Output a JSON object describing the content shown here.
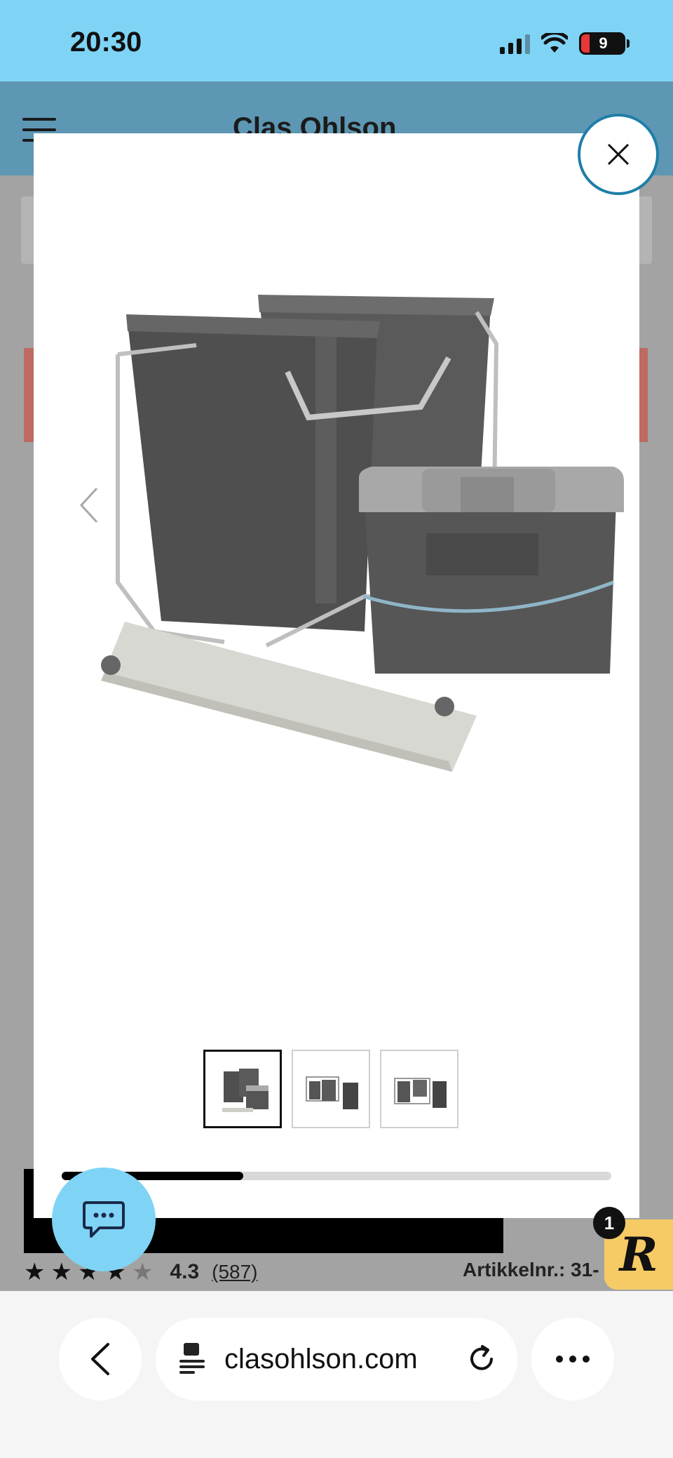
{
  "status_bar": {
    "time": "20:30",
    "battery_level": "9",
    "icons": [
      "signal-icon",
      "wifi-icon",
      "battery-icon"
    ]
  },
  "site_behind": {
    "logo": "Clas Ohlson",
    "rating_value": "4.3",
    "rating_count": "(587)",
    "rating_stars": 4.3,
    "article_number": "Artikkelnr.: 31-"
  },
  "modal": {
    "close_icon": "close-icon",
    "prev_icon": "chevron-left-icon",
    "next_icon": "chevron-right-icon",
    "image_name": "product-image-waste-bins",
    "thumbnails": [
      {
        "name": "thumb-1",
        "active": true
      },
      {
        "name": "thumb-2",
        "active": false
      },
      {
        "name": "thumb-3",
        "active": false
      }
    ],
    "progress": 0.33
  },
  "widgets": {
    "chat_icon": "chat-icon",
    "r_badge_letter": "R",
    "notification_count": "1"
  },
  "browser": {
    "url": "clasohlson.com",
    "back_icon": "back-icon",
    "reader_icon": "page-settings-icon",
    "reload_icon": "reload-icon",
    "more_icon": "more-icon"
  },
  "colors": {
    "status_bar": "#7fd4f6",
    "close_border": "#1e7ea8",
    "badge": "#f6cb66"
  }
}
